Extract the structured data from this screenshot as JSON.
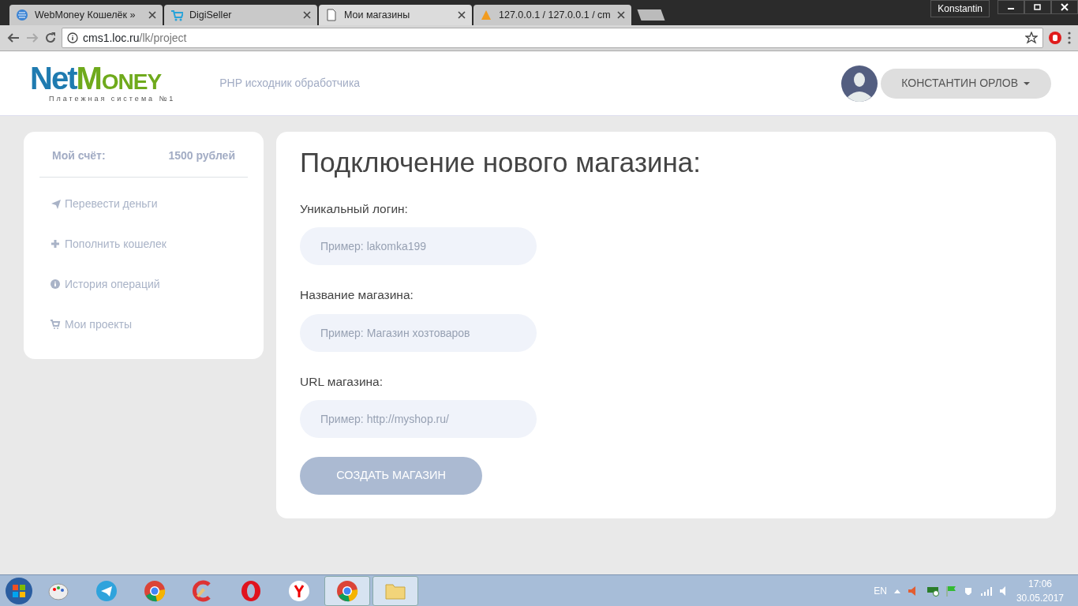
{
  "browser": {
    "profile": "Konstantin",
    "tabs": [
      {
        "title": "WebMoney Кошелёк »",
        "kind": "globe",
        "selected": false
      },
      {
        "title": "DigiSeller",
        "kind": "cart",
        "selected": false
      },
      {
        "title": "Мои магазины",
        "kind": "page",
        "selected": true
      },
      {
        "title": "127.0.0.1 / 127.0.0.1 / cm",
        "kind": "pma",
        "selected": false
      }
    ],
    "address": {
      "host": "cms1.loc.ru",
      "path": "/lk/project"
    }
  },
  "header": {
    "logo": {
      "part1": "Net",
      "part2": "Money",
      "tagline": "Платежная система №1"
    },
    "nav_link": "PHP исходник обработчика",
    "user": "КОНСТАНТИН ОРЛОВ"
  },
  "sidebar": {
    "balance_label": "Мой счёт:",
    "balance": "1500 рублей",
    "items": [
      {
        "label": "Перевести деньги",
        "kind": "send"
      },
      {
        "label": "Пополнить кошелек",
        "kind": "plus"
      },
      {
        "label": "История операций",
        "kind": "info"
      },
      {
        "label": "Мои проекты",
        "kind": "cart"
      }
    ]
  },
  "form": {
    "title": "Подключение нового магазина:",
    "fields": [
      {
        "label": "Уникальный логин:",
        "placeholder": "Пример: lakomka199"
      },
      {
        "label": "Название магазина:",
        "placeholder": "Пример: Магазин хозтоваров"
      },
      {
        "label": "URL магазина:",
        "placeholder": "Пример: http://myshop.ru/"
      }
    ],
    "submit": "СОЗДАТЬ МАГАЗИН"
  },
  "taskbar": {
    "apps": [
      {
        "kind": "paint",
        "active": false
      },
      {
        "kind": "telegram",
        "active": false
      },
      {
        "kind": "chrome",
        "active": false
      },
      {
        "kind": "ccleaner",
        "active": false
      },
      {
        "kind": "opera",
        "active": false
      },
      {
        "kind": "yandex",
        "active": false
      },
      {
        "kind": "chrome",
        "active": true
      },
      {
        "kind": "folder",
        "active": true
      }
    ],
    "language": "EN",
    "time": "17:06",
    "date": "30.05.2017"
  }
}
